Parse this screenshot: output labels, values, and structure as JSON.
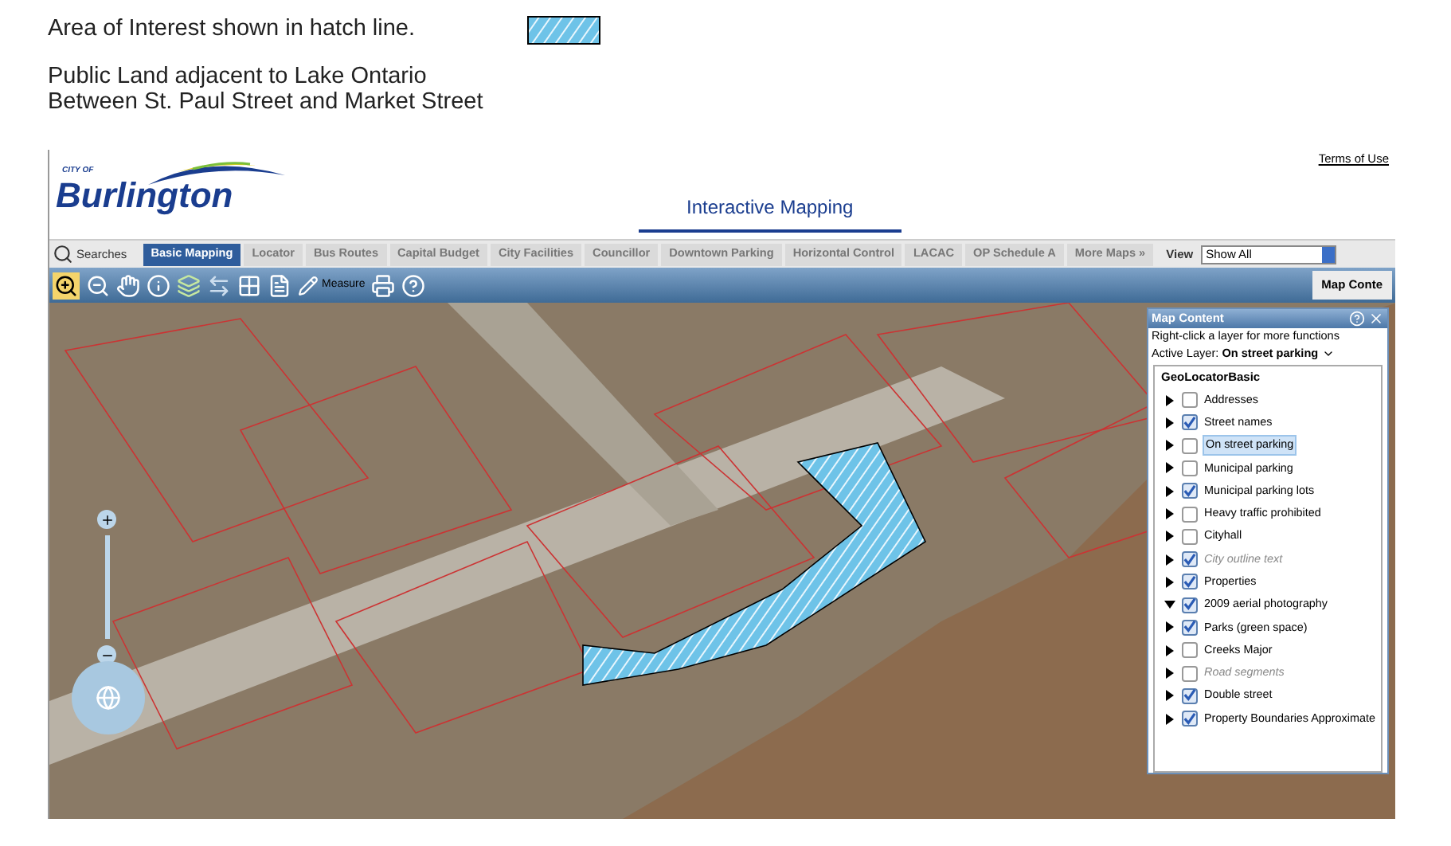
{
  "legend": {
    "text": "Area of Interest shown in hatch line."
  },
  "description": [
    "Public Land adjacent to Lake Ontario",
    "Between St. Paul Street and Market Street"
  ],
  "header": {
    "logo_small": "CITY OF",
    "logo": "Burlington",
    "terms_link": "Terms of Use",
    "title": "Interactive Mapping"
  },
  "searches": {
    "label": "Searches"
  },
  "tabs": [
    {
      "label": "Basic Mapping",
      "selected": true
    },
    {
      "label": "Locator",
      "selected": false
    },
    {
      "label": "Bus Routes",
      "selected": false
    },
    {
      "label": "Capital Budget",
      "selected": false
    },
    {
      "label": "City Facilities",
      "selected": false
    },
    {
      "label": "Councillor",
      "selected": false
    },
    {
      "label": "Downtown Parking",
      "selected": false
    },
    {
      "label": "Horizontal Control",
      "selected": false
    },
    {
      "label": "LACAC",
      "selected": false
    },
    {
      "label": "OP Schedule A",
      "selected": false
    },
    {
      "label": "More Maps »",
      "selected": false
    }
  ],
  "view": {
    "label": "View",
    "value": "Show All"
  },
  "toolbar": {
    "measure_label": "Measure",
    "map_content_button": "Map Conte"
  },
  "map_content": {
    "title": "Map Content",
    "hint": "Right-click a layer for more functions",
    "active_layer_label": "Active Layer:",
    "active_layer_value": "On street parking",
    "root": "GeoLocatorBasic",
    "layers": [
      {
        "name": "Addresses",
        "checked": false,
        "disabled": false,
        "expanded": false,
        "selected": false
      },
      {
        "name": "Street names",
        "checked": true,
        "disabled": false,
        "expanded": false,
        "selected": false
      },
      {
        "name": "On street parking",
        "checked": false,
        "disabled": false,
        "expanded": false,
        "selected": true
      },
      {
        "name": "Municipal parking",
        "checked": false,
        "disabled": false,
        "expanded": false,
        "selected": false
      },
      {
        "name": "Municipal parking lots",
        "checked": true,
        "disabled": false,
        "expanded": false,
        "selected": false
      },
      {
        "name": "Heavy traffic prohibited",
        "checked": false,
        "disabled": false,
        "expanded": false,
        "selected": false
      },
      {
        "name": "Cityhall",
        "checked": false,
        "disabled": false,
        "expanded": false,
        "selected": false
      },
      {
        "name": "City outline text",
        "checked": true,
        "disabled": true,
        "expanded": false,
        "selected": false
      },
      {
        "name": "Properties",
        "checked": true,
        "disabled": false,
        "expanded": false,
        "selected": false
      },
      {
        "name": "2009 aerial photography",
        "checked": true,
        "disabled": false,
        "expanded": true,
        "selected": false
      },
      {
        "name": "Parks (green space)",
        "checked": true,
        "disabled": false,
        "expanded": false,
        "selected": false
      },
      {
        "name": "Creeks Major",
        "checked": false,
        "disabled": false,
        "expanded": false,
        "selected": false
      },
      {
        "name": "Road segments",
        "checked": false,
        "disabled": true,
        "expanded": false,
        "selected": false
      },
      {
        "name": "Double street",
        "checked": true,
        "disabled": false,
        "expanded": false,
        "selected": false
      },
      {
        "name": "Property Boundaries Approximate",
        "checked": true,
        "disabled": false,
        "expanded": false,
        "selected": false
      }
    ]
  }
}
